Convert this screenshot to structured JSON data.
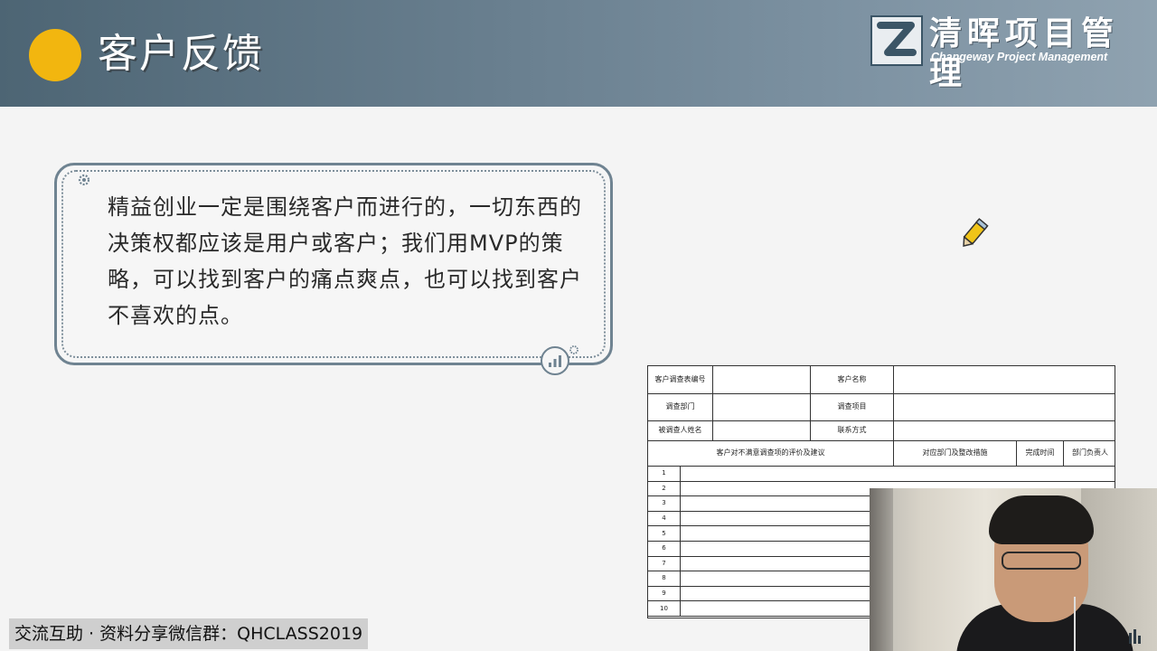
{
  "header": {
    "title": "客户反馈",
    "accent_color": "#f2b60f",
    "logo": {
      "name_cn": "清晖项目管理",
      "name_en": "Changeway Project Management",
      "icon": "z-logo-icon"
    }
  },
  "card": {
    "text": "精益创业一定是围绕客户而进行的，一切东西的决策权都应该是用户或客户；我们用MVP的策略，可以找到客户的痛点爽点，也可以找到客户不喜欢的点。",
    "icons": [
      "gear-icon",
      "signal-bars-icon"
    ]
  },
  "decoration": {
    "icon": "pencil-icon"
  },
  "survey_form": {
    "fields": [
      {
        "label": "客户调查表编号",
        "label2": "客户名称"
      },
      {
        "label": "调查部门",
        "label2": "调查项目"
      },
      {
        "label": "被调查人姓名",
        "label2": "联系方式"
      }
    ],
    "columns": [
      "客户对不满意调查项的评价及建议",
      "对应部门及整改措施",
      "完成时间",
      "部门负责人"
    ],
    "row_numbers": [
      "1",
      "2",
      "3",
      "4",
      "5",
      "6",
      "7",
      "8",
      "9",
      "10"
    ]
  },
  "watermark": {
    "text": "交流互助 · 资料分享微信群：QHCLASS2019"
  }
}
